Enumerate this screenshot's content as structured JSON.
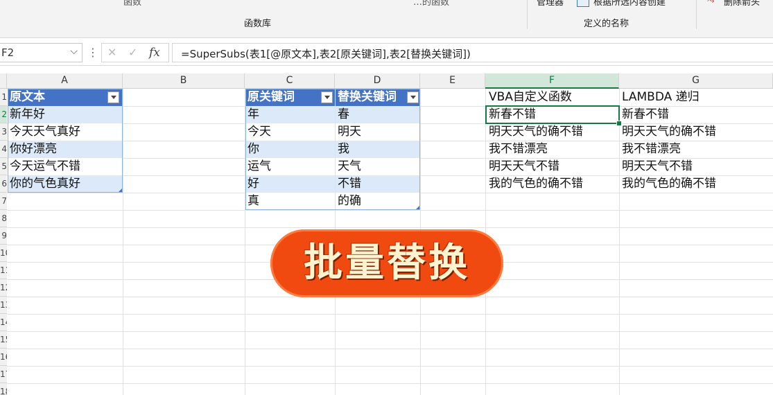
{
  "ribbon": {
    "top_left_fragment": "函数",
    "top_mid_fragment": "…的函数",
    "top_right_fragment_1": "管理器",
    "top_right_fragment_2": "根据所选内容创建",
    "top_right_fragment_3": "删除箭头",
    "group_function_library": "函数库",
    "group_defined_names": "定义的名称"
  },
  "formula_bar": {
    "name_box": "F2",
    "formula": "=SuperSubs(表1[@原文本],表2[原关键词],表2[替换关键词])",
    "fx_label": "fx"
  },
  "columns": [
    "A",
    "B",
    "C",
    "D",
    "E",
    "F",
    "G"
  ],
  "row_numbers": [
    "1",
    "2",
    "3",
    "4",
    "5",
    "6",
    "7",
    "8",
    "9",
    "10",
    "11",
    "12",
    "13",
    "14",
    "15",
    "16",
    "17",
    "18"
  ],
  "table1": {
    "header": "原文本",
    "rows": [
      "新年好",
      "今天天气真好",
      "你好漂亮",
      "今天运气不错",
      "你的气色真好"
    ]
  },
  "table2": {
    "header_keyword": "原关键词",
    "header_replace": "替换关键词",
    "keywords": [
      "年",
      "今天",
      "你",
      "运气",
      "好",
      "真"
    ],
    "replacements": [
      "春",
      "明天",
      "我",
      "天气",
      "不错",
      "的确"
    ]
  },
  "column_f": {
    "header": "VBA自定义函数",
    "rows": [
      "新春不错",
      "明天天气的确不错",
      "我不错漂亮",
      "明天天气不错",
      "我的气色的确不错"
    ]
  },
  "column_g": {
    "header": "LAMBDA 递归",
    "rows": [
      "新春不错",
      "明天天气的确不错",
      "我不错漂亮",
      "明天天气不错",
      "我的气色的确不错"
    ]
  },
  "overlay_title": "批量替换",
  "colors": {
    "table_header": "#4472c4",
    "table_band": "#dce9f8",
    "selection": "#107c41",
    "badge": "#f04a10"
  }
}
